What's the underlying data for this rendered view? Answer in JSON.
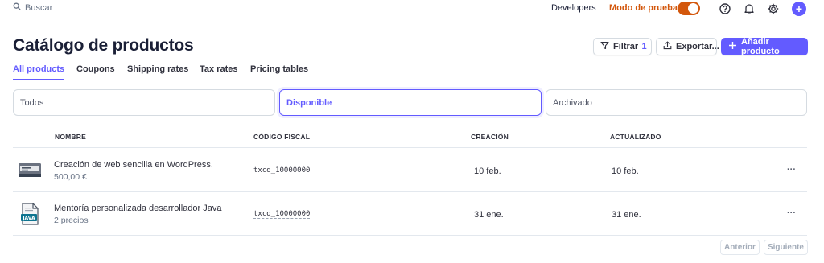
{
  "topbar": {
    "search_placeholder": "Buscar",
    "developers": "Developers",
    "test_mode": "Modo de prueba",
    "test_mode_on": true
  },
  "header": {
    "title": "Catálogo de productos",
    "filter_label": "Filtrar",
    "filter_count": "1",
    "export_label": "Exportar...",
    "add_label": "Añadir producto"
  },
  "tabs": [
    {
      "label": "All products",
      "active": true
    },
    {
      "label": "Coupons",
      "active": false
    },
    {
      "label": "Shipping rates",
      "active": false
    },
    {
      "label": "Tax rates",
      "active": false
    },
    {
      "label": "Pricing tables",
      "active": false
    }
  ],
  "segments": [
    {
      "label": "Todos",
      "active": false
    },
    {
      "label": "Disponible",
      "active": true
    },
    {
      "label": "Archivado",
      "active": false
    }
  ],
  "table": {
    "columns": [
      "NOMBRE",
      "CÓDIGO FISCAL",
      "CREACIÓN",
      "ACTUALIZADO"
    ],
    "rows": [
      {
        "name": "Creación de web sencilla en WordPress.",
        "sub": "500,00 €",
        "tax_code": "txcd_10000000",
        "created": "10 feb.",
        "updated": "10 feb.",
        "more": "···",
        "thumb_icon": "website-thumbnail-icon"
      },
      {
        "name": "Mentoría personalizada desarrollador Java",
        "sub": "2 precios",
        "tax_code": "txcd_10000000",
        "created": "31 ene.",
        "updated": "31 ene.",
        "more": "···",
        "thumb_icon": "java-file-icon"
      }
    ]
  },
  "pagination": {
    "prev": "Anterior",
    "next": "Siguiente"
  },
  "colors": {
    "accent": "#635bff",
    "test_mode": "#d3570c"
  }
}
